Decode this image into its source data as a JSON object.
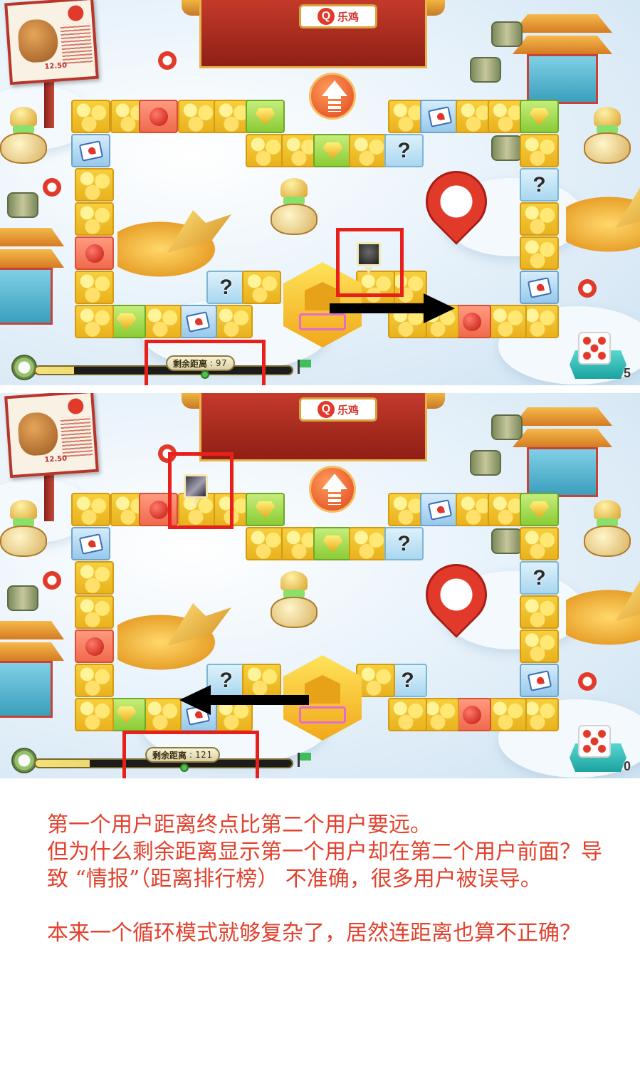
{
  "screens": [
    {
      "gate_sign": {
        "q": "Q",
        "text": "乐鸡"
      },
      "billboard": {
        "price": "12.50"
      },
      "remaining": {
        "label": "剩余距离",
        "separator": ":",
        "value": "97"
      },
      "progress_fraction": 0.15,
      "dice_count": "5",
      "arrow_direction": "right"
    },
    {
      "gate_sign": {
        "q": "Q",
        "text": "乐鸡"
      },
      "billboard": {
        "price": "12.50"
      },
      "remaining": {
        "label": "剩余距离",
        "separator": ":",
        "value": "121"
      },
      "progress_fraction": 0.21,
      "dice_count": "0",
      "arrow_direction": "left"
    }
  ],
  "caption": {
    "line1": "第一个用户距离终点比第二个用户要远。",
    "line2": "但为什么剩余距离显示第一个用户却在第二个用户前面？导致 “情报”（距离排行榜） 不准确，很多用户被误导。",
    "line3": "本来一个循环模式就够复杂了，居然连距离也算不正确？"
  },
  "colors": {
    "highlight": "#e8201c",
    "caption_text": "#e2422e",
    "tile_gold": "#f7cf3d",
    "arrow": "#000000"
  },
  "icons": [
    "q-logo-icon",
    "up-arrow-icon",
    "bomb-icon",
    "gem-icon",
    "question-icon",
    "card-icon",
    "dice-icon",
    "flag-icon",
    "location-marker-icon"
  ]
}
